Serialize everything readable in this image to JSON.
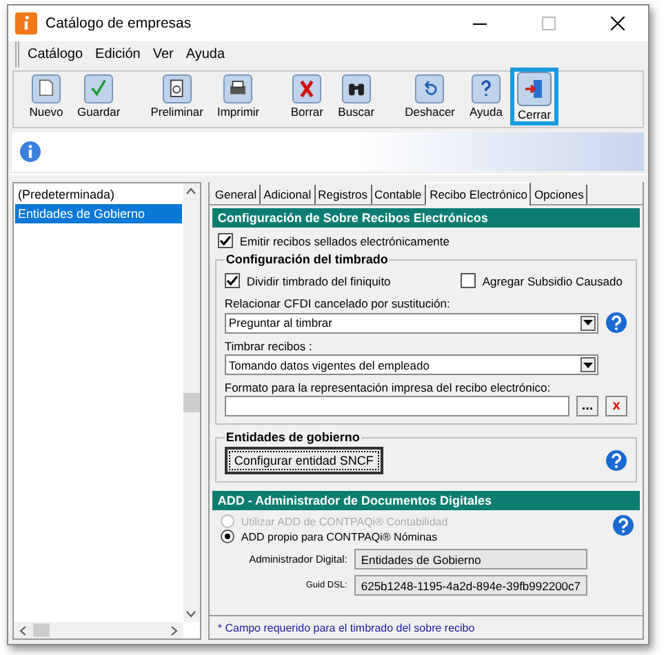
{
  "window": {
    "title": "Catálogo de empresas"
  },
  "menu": [
    "Catálogo",
    "Edición",
    "Ver",
    "Ayuda"
  ],
  "toolbar": [
    {
      "label": "Nuevo",
      "selected": false
    },
    {
      "label": "Guardar",
      "selected": false
    },
    {
      "label": "Preliminar",
      "selected": false
    },
    {
      "label": "Imprimir",
      "selected": false
    },
    {
      "label": "Borrar",
      "selected": false
    },
    {
      "label": "Buscar",
      "selected": false
    },
    {
      "label": "Deshacer",
      "selected": false
    },
    {
      "label": "Ayuda",
      "selected": false
    },
    {
      "label": "Cerrar",
      "selected": true
    }
  ],
  "list": [
    {
      "label": "(Predeterminada)",
      "selected": false
    },
    {
      "label": "Entidades de Gobierno",
      "selected": true
    }
  ],
  "tabs": [
    {
      "label": "General",
      "selected": false
    },
    {
      "label": "Adicional",
      "selected": false
    },
    {
      "label": "Registros",
      "selected": false
    },
    {
      "label": "Contable",
      "selected": false
    },
    {
      "label": "Recibo Electrónico",
      "selected": true
    },
    {
      "label": "Opciones",
      "selected": false
    }
  ],
  "section_header": "Configuración de Sobre Recibos Electrónicos",
  "emit": {
    "label": "Emitir recibos sellados electrónicamente",
    "checked": true
  },
  "timbrado": {
    "title": "Configuración del timbrado",
    "dividir": {
      "label": "Dividir timbrado del finiquito",
      "checked": true
    },
    "subsidio": {
      "label": "Agregar Subsidio Causado",
      "checked": false
    },
    "relacionar": {
      "label": "Relacionar CFDI cancelado por sustitución:",
      "value": "Preguntar al timbrar"
    },
    "timbrar": {
      "label": "Timbrar recibos :",
      "value": "Tomando datos vigentes del empleado"
    },
    "formato": {
      "label": "Formato para la representación impresa del recibo electrónico:",
      "browse": "...",
      "clear": "x"
    }
  },
  "entidades": {
    "title": "Entidades de gobierno",
    "button": "Configurar entidad SNCF"
  },
  "add_header": "ADD - Administrador de Documentos Digitales",
  "add_options": [
    {
      "label": "Utilizar ADD de CONTPAQi® Contabilidad",
      "selected": false,
      "disabled": true
    },
    {
      "label": "ADD propio para CONTPAQi® Nóminas",
      "selected": true,
      "disabled": false
    }
  ],
  "admin": {
    "label": "Administrador Digital:",
    "value": "Entidades de Gobierno"
  },
  "guid": {
    "label": "Guid DSL:",
    "value": "625b1248-1195-4a2d-894e-39fb992200c7"
  },
  "footer": "* Campo requerido para el timbrado del sobre recibo"
}
